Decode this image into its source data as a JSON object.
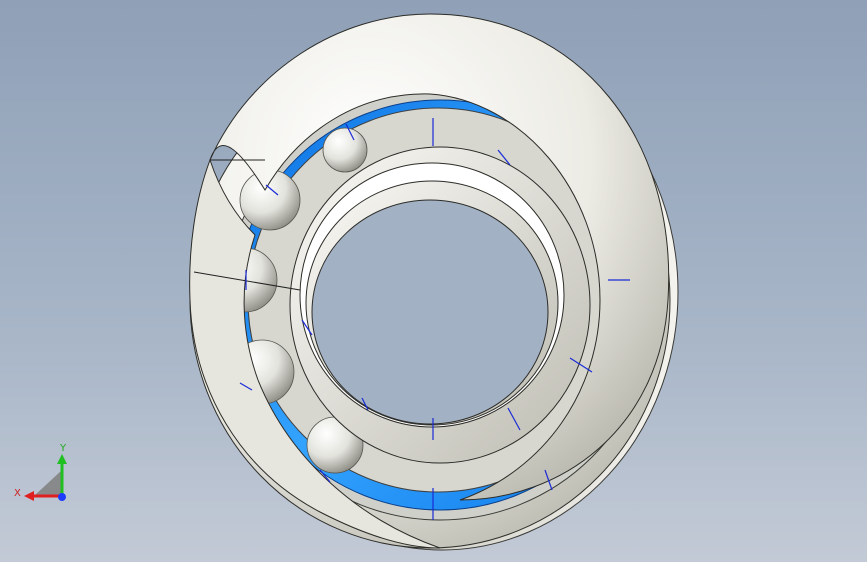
{
  "viewport": {
    "background_top": "#8fa0b7",
    "background_bottom": "#c3cad6"
  },
  "model": {
    "type": "thrust ball bearing",
    "ring_color": "#f1f0ea",
    "ring_shadow": "#b9b8ae",
    "raceway_color": "#1a8cf0",
    "ball_color": "#e9e9e4",
    "sketch_line_color": "#1a2bd6"
  },
  "triad": {
    "x_label": "X",
    "y_label": "Y",
    "x_color": "#e02020",
    "y_color": "#20c020",
    "z_color": "#1e3cff",
    "icon": "coordinate-axes-icon"
  }
}
